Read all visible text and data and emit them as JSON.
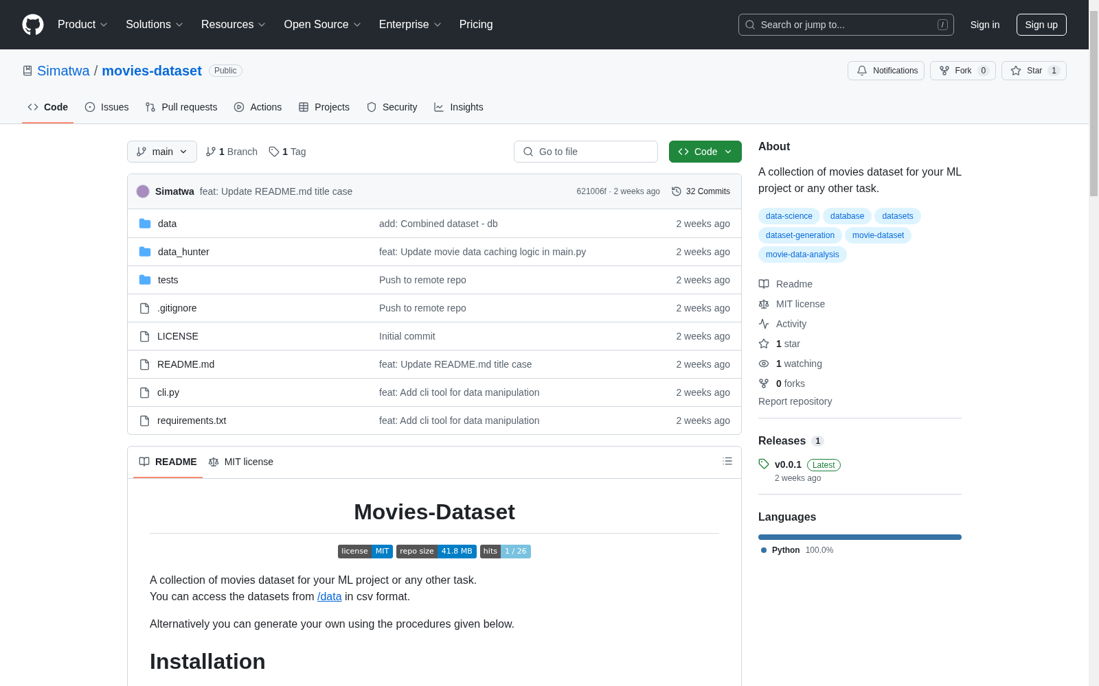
{
  "nav": {
    "items": [
      {
        "label": "Product",
        "dropdown": true
      },
      {
        "label": "Solutions",
        "dropdown": true
      },
      {
        "label": "Resources",
        "dropdown": true
      },
      {
        "label": "Open Source",
        "dropdown": true
      },
      {
        "label": "Enterprise",
        "dropdown": true
      },
      {
        "label": "Pricing",
        "dropdown": false
      }
    ],
    "search_placeholder": "Search or jump to...",
    "search_key": "/",
    "sign_in": "Sign in",
    "sign_up": "Sign up"
  },
  "repo": {
    "owner": "Simatwa",
    "separator": "/",
    "name": "movies-dataset",
    "visibility": "Public",
    "actions": [
      {
        "kind": "notifications",
        "label": "Notifications"
      },
      {
        "kind": "fork",
        "label": "Fork",
        "count": "0"
      },
      {
        "kind": "star",
        "label": "Star",
        "count": "1"
      }
    ]
  },
  "tabs": [
    {
      "kind": "code",
      "label": "Code",
      "selected": true
    },
    {
      "kind": "issues",
      "label": "Issues",
      "selected": false
    },
    {
      "kind": "pulls",
      "label": "Pull requests",
      "selected": false
    },
    {
      "kind": "actions",
      "label": "Actions",
      "selected": false
    },
    {
      "kind": "projects",
      "label": "Projects",
      "selected": false
    },
    {
      "kind": "security",
      "label": "Security",
      "selected": false
    },
    {
      "kind": "insights",
      "label": "Insights",
      "selected": false
    }
  ],
  "toolbar": {
    "branch": "main",
    "branch_count": "1",
    "branch_label": "Branch",
    "tag_count": "1",
    "tag_label": "Tag",
    "goto_placeholder": "Go to file",
    "code_button": "Code"
  },
  "commit": {
    "author": "Simatwa",
    "message": "feat: Update README.md title case",
    "hash_time": "621006f · 2 weeks ago",
    "commits": "32 Commits"
  },
  "files": [
    {
      "kind": "folder",
      "name": "data",
      "message": "add: Combined dataset - db",
      "time": "2 weeks ago"
    },
    {
      "kind": "folder",
      "name": "data_hunter",
      "message": "feat: Update movie data caching logic in main.py",
      "time": "2 weeks ago"
    },
    {
      "kind": "folder",
      "name": "tests",
      "message": "Push to remote repo",
      "time": "2 weeks ago"
    },
    {
      "kind": "file",
      "name": ".gitignore",
      "message": "Push to remote repo",
      "time": "2 weeks ago"
    },
    {
      "kind": "file",
      "name": "LICENSE",
      "message": "Initial commit",
      "time": "2 weeks ago"
    },
    {
      "kind": "file",
      "name": "README.md",
      "message": "feat: Update README.md title case",
      "time": "2 weeks ago"
    },
    {
      "kind": "file",
      "name": "cli.py",
      "message": "feat: Add cli tool for data manipulation",
      "time": "2 weeks ago"
    },
    {
      "kind": "file",
      "name": "requirements.txt",
      "message": "feat: Add cli tool for data manipulation",
      "time": "2 weeks ago"
    }
  ],
  "readme_tabs": [
    {
      "kind": "readme",
      "label": "README",
      "selected": true
    },
    {
      "kind": "license",
      "label": "MIT license",
      "selected": false
    }
  ],
  "readme": {
    "title": "Movies-Dataset",
    "badges": [
      {
        "label": "license",
        "value": "MIT",
        "color": "#007ec6"
      },
      {
        "label": "repo size",
        "value": "41.8 MB",
        "color": "#007ec6"
      },
      {
        "label": "hits",
        "value": "1 / 26",
        "color": "#79c2e0"
      }
    ],
    "intro_line": "A collection of movies dataset for your ML project or any other task.",
    "access_before": "You can access the datasets from ",
    "access_link": "/data",
    "access_after": " in csv format.",
    "paragraph": "Alternatively you can generate your own using the procedures given below.",
    "heading": "Installation"
  },
  "about": {
    "heading": "About",
    "description": "A collection of movies dataset for your ML project or any other task.",
    "topics": [
      "data-science",
      "database",
      "datasets",
      "dataset-generation",
      "movie-dataset",
      "movie-data-analysis"
    ],
    "links": [
      {
        "kind": "readme",
        "label": "Readme"
      },
      {
        "kind": "license",
        "label": "MIT license"
      },
      {
        "kind": "activity",
        "label": "Activity"
      },
      {
        "kind": "star",
        "count": "1",
        "label": "star"
      },
      {
        "kind": "watch",
        "count": "1",
        "label": "watching"
      },
      {
        "kind": "fork",
        "count": "0",
        "label": "forks"
      }
    ],
    "report": "Report repository"
  },
  "releases": {
    "heading": "Releases",
    "count": "1",
    "tag": "v0.0.1",
    "badge": "Latest",
    "time": "2 weeks ago"
  },
  "languages": {
    "heading": "Languages",
    "items": [
      {
        "name": "Python",
        "percent": "100.0%",
        "color": "#3572a5",
        "level": 1
      }
    ]
  }
}
